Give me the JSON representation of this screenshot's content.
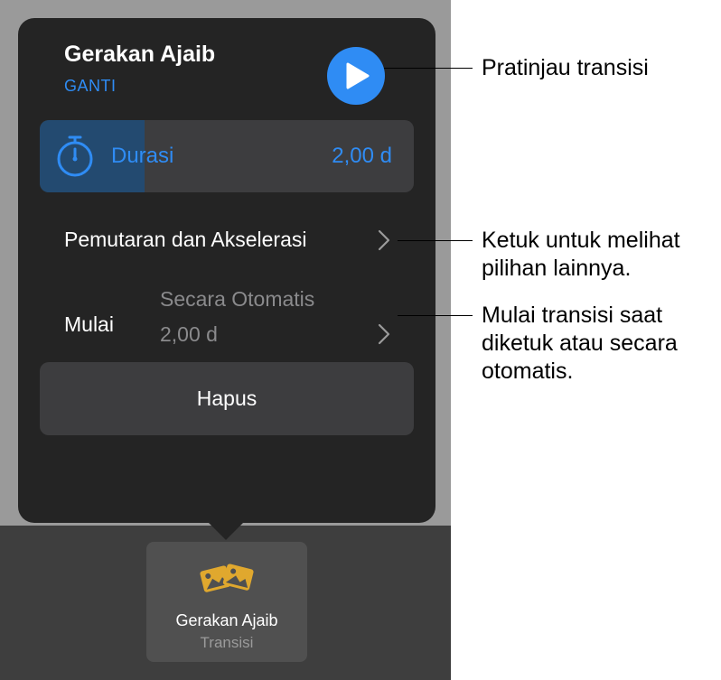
{
  "popover": {
    "title": "Gerakan Ajaib",
    "change_label": "GANTI",
    "play_icon": "play-icon",
    "duration": {
      "label": "Durasi",
      "value": "2,00 d",
      "icon": "stopwatch-icon",
      "fill_fraction": 0.28
    },
    "playback_row": {
      "label": "Pemutaran dan Akselerasi"
    },
    "start_row": {
      "label": "Mulai",
      "value_line1": "Secara Otomatis",
      "value_line2": "2,00 d"
    },
    "delete_label": "Hapus"
  },
  "tile": {
    "icon": "magic-move-icon",
    "title": "Gerakan Ajaib",
    "subtitle": "Transisi"
  },
  "callouts": {
    "preview": "Pratinjau transisi",
    "options_line1": "Ketuk untuk melihat",
    "options_line2": "pilihan lainnya.",
    "start_line1": "Mulai transisi saat",
    "start_line2": "diketuk atau secara",
    "start_line3": "otomatis."
  },
  "colors": {
    "accent": "#2f8cf4",
    "popover_bg": "#242424",
    "row_bg": "#3d3d3f",
    "icon_gold": "#e0a82e"
  }
}
